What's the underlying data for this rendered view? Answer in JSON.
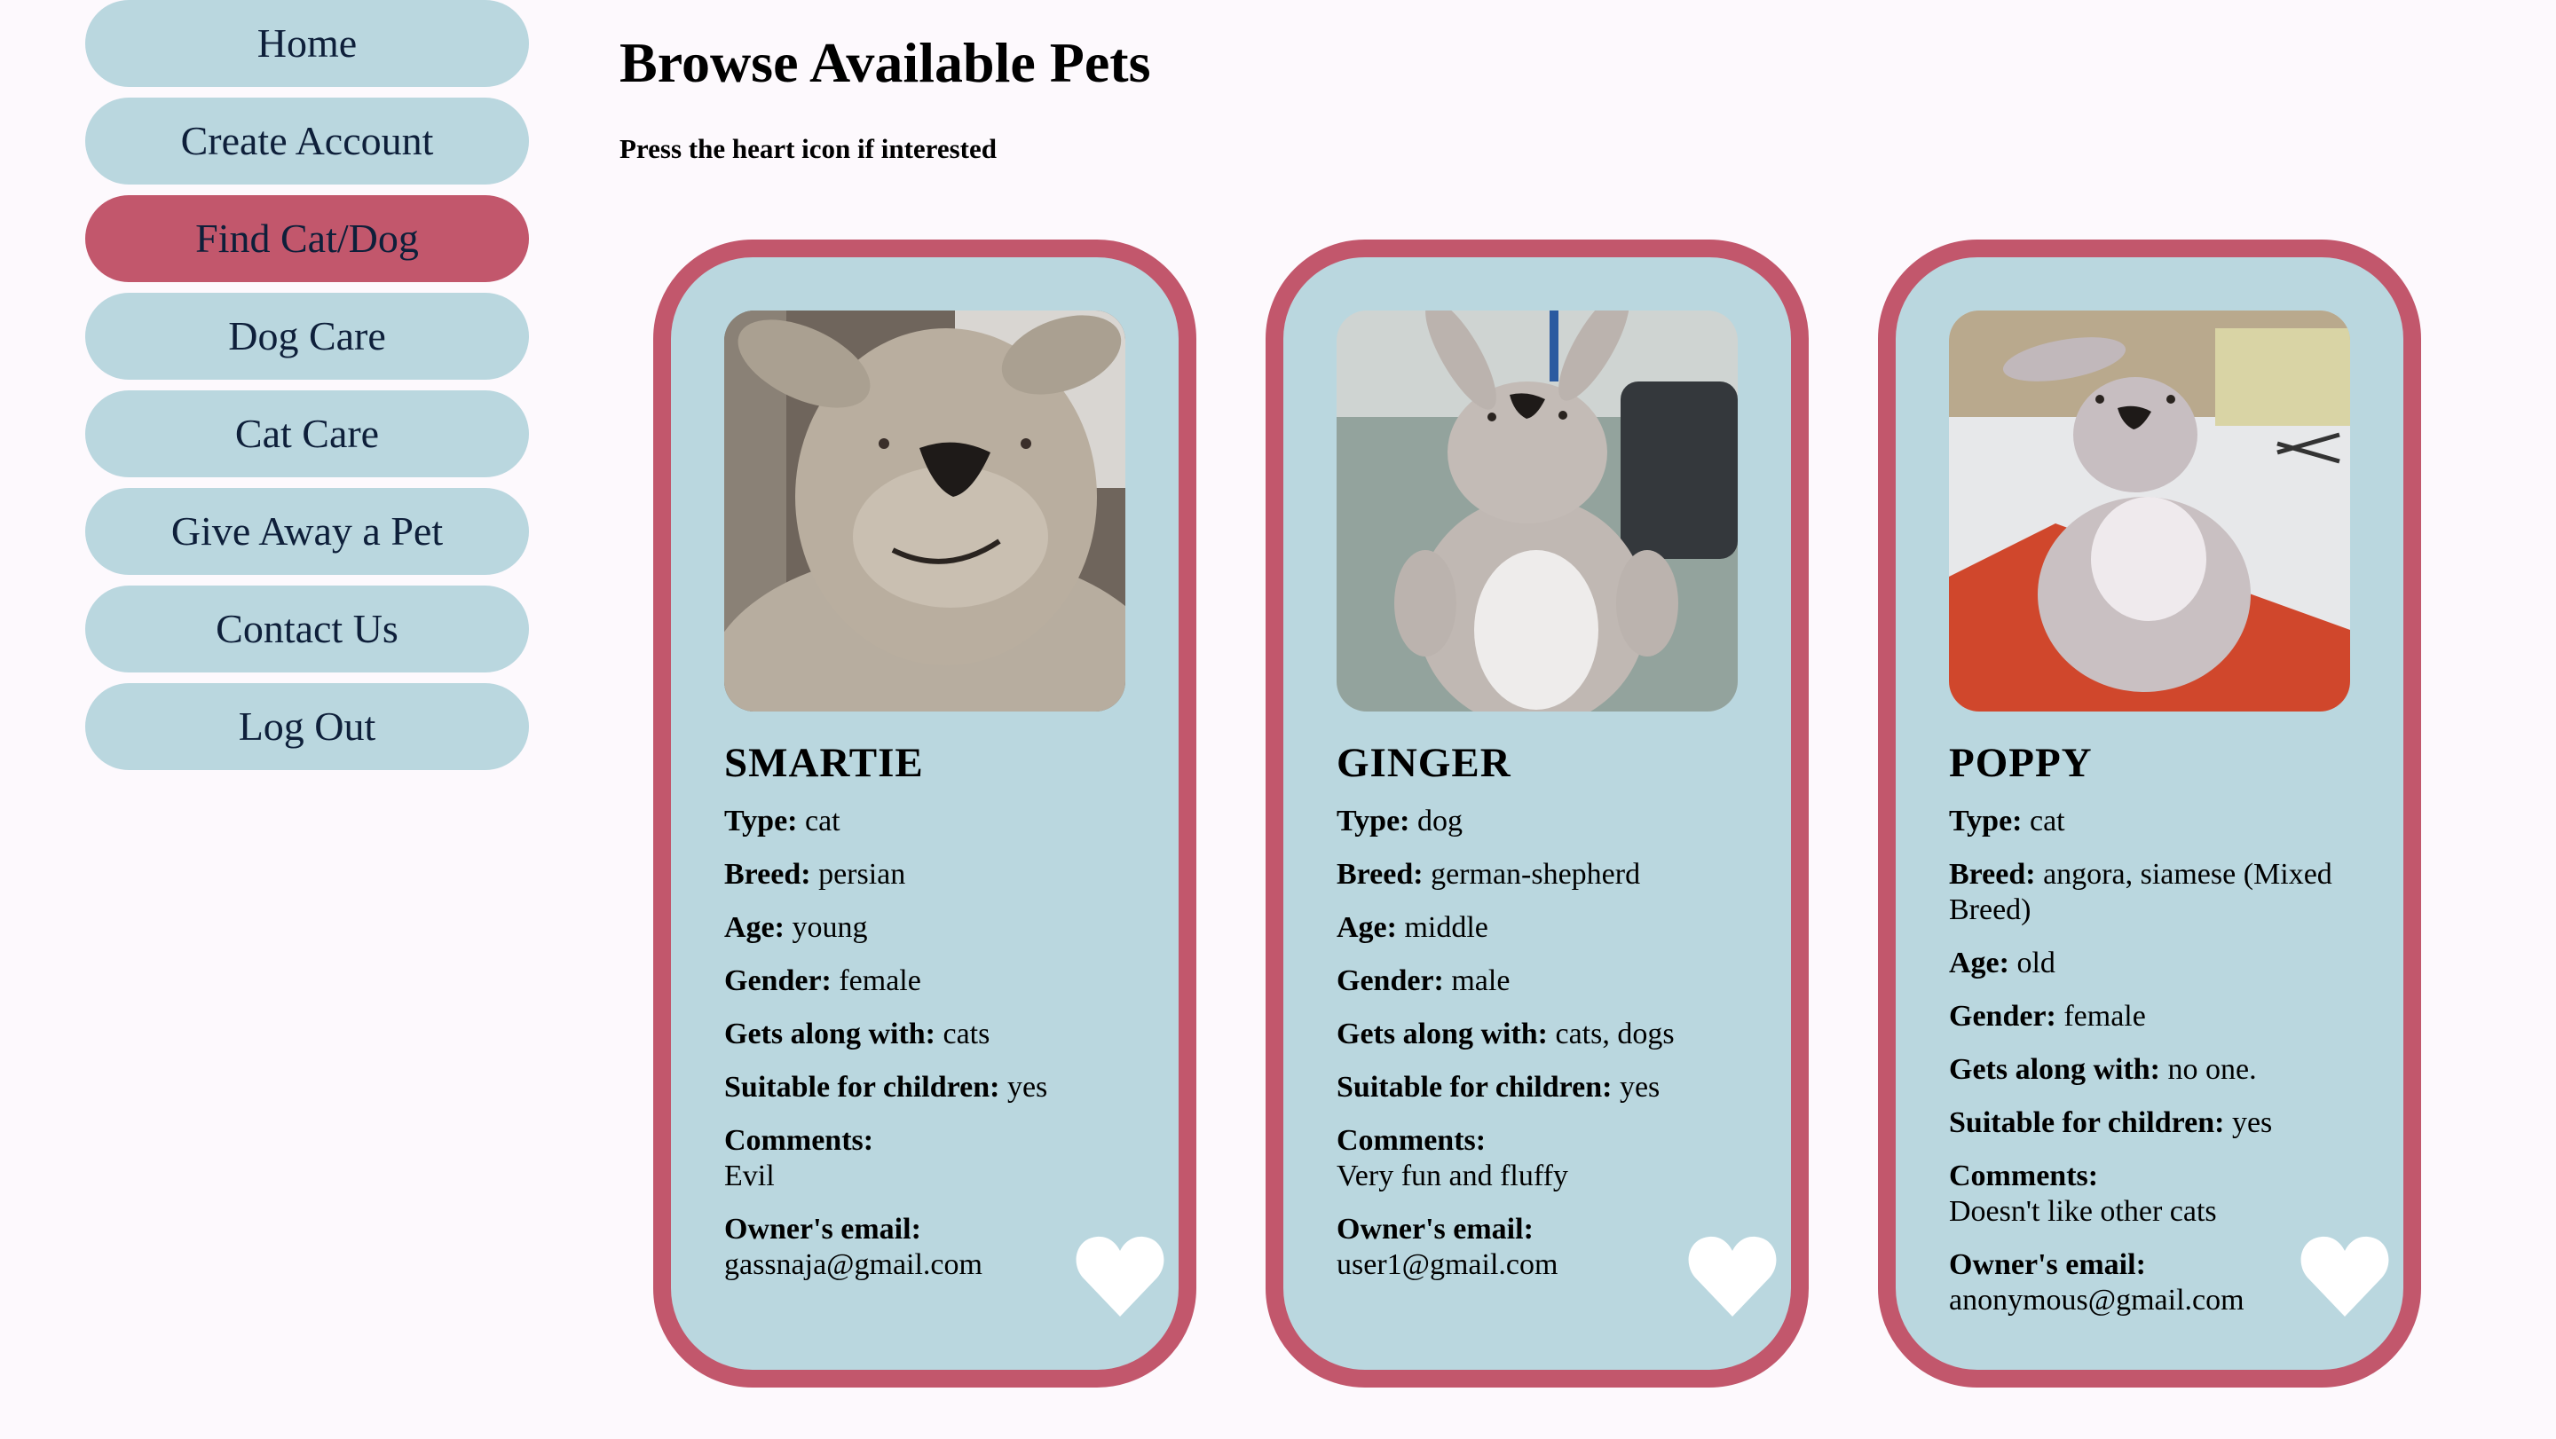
{
  "nav": {
    "items": [
      {
        "label": "Home",
        "active": false
      },
      {
        "label": "Create Account",
        "active": false
      },
      {
        "label": "Find Cat/Dog",
        "active": true
      },
      {
        "label": "Dog Care",
        "active": false
      },
      {
        "label": "Cat Care",
        "active": false
      },
      {
        "label": "Give Away a Pet",
        "active": false
      },
      {
        "label": "Contact Us",
        "active": false
      },
      {
        "label": "Log Out",
        "active": false
      }
    ]
  },
  "page": {
    "title": "Browse Available Pets",
    "subtitle": "Press the heart icon if interested"
  },
  "labels": {
    "type": "Type:",
    "breed": "Breed:",
    "age": "Age:",
    "gender": "Gender:",
    "gets_along": "Gets along with:",
    "suitable": "Suitable for children:",
    "comments": "Comments:",
    "email": "Owner's email:"
  },
  "pets": [
    {
      "name": "SMARTIE",
      "type": "cat",
      "breed": "persian",
      "age": "young",
      "gender": "female",
      "gets_along": "cats",
      "suitable": "yes",
      "comments": "Evil",
      "email": "gassnaja@gmail.com"
    },
    {
      "name": "GINGER",
      "type": "dog",
      "breed": "german-shepherd",
      "age": "middle",
      "gender": "male",
      "gets_along": "cats, dogs",
      "suitable": "yes",
      "comments": "Very fun and fluffy",
      "email": "user1@gmail.com"
    },
    {
      "name": "POPPY",
      "type": "cat",
      "breed": "angora, siamese (Mixed Breed)",
      "age": "old",
      "gender": "female",
      "gets_along": "no one.",
      "suitable": "yes",
      "comments": "Doesn't like other cats",
      "email": "anonymous@gmail.com"
    }
  ],
  "colors": {
    "page_bg": "#fdf9fd",
    "nav_bg": "#bad7df",
    "nav_active": "#c2576c",
    "card_bg": "#bad7df",
    "card_border": "#c2576c",
    "heart": "#ffffff"
  },
  "icons": {
    "heart": "heart-icon"
  }
}
